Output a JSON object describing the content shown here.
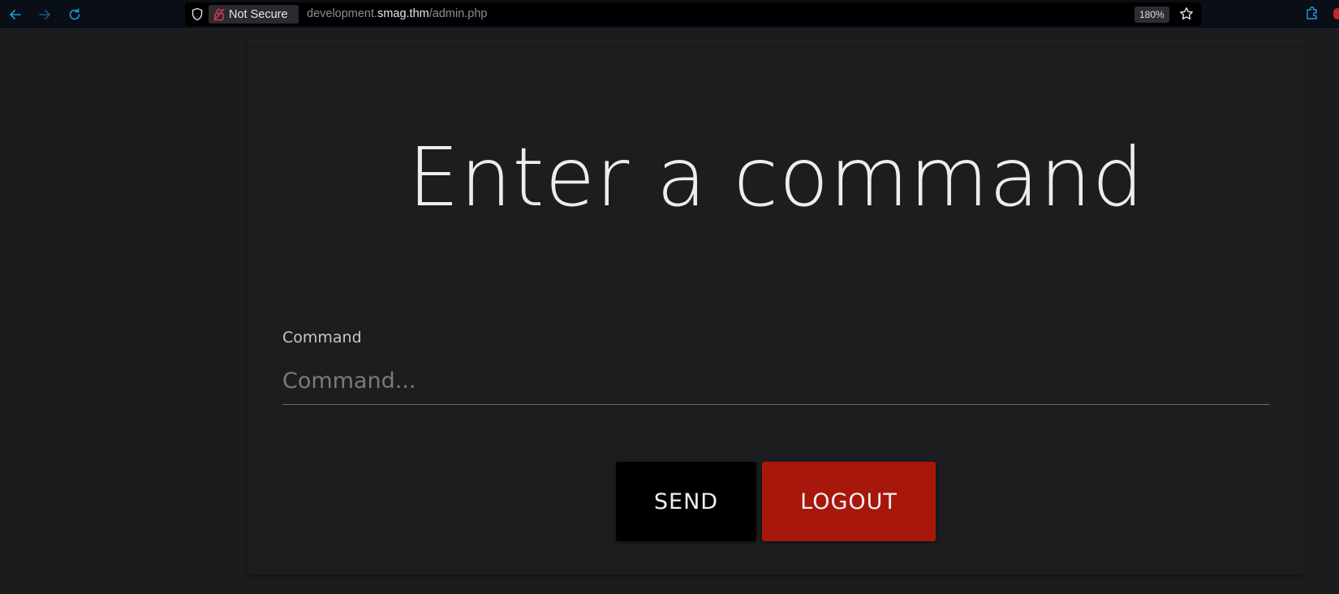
{
  "browser": {
    "security_label": "Not Secure",
    "url": {
      "prefix": "development.",
      "host": "smag.thm",
      "path": "/admin.php"
    },
    "zoom": "180%",
    "icons": {
      "back": "arrow-left-icon",
      "forward": "arrow-right-icon",
      "reload": "reload-icon",
      "tracking": "shield-icon",
      "insecure": "lock-broken-icon",
      "bookmark": "star-icon",
      "extensions": "extensions-icon"
    },
    "colors": {
      "accent": "#1a9bd7",
      "insecure_red": "#d6365a"
    }
  },
  "page": {
    "title": "Enter a command",
    "command": {
      "label": "Command",
      "placeholder": "Command...",
      "value": ""
    },
    "buttons": {
      "send": "SEND",
      "logout": "LOGOUT"
    },
    "colors": {
      "background": "#1b1c1e",
      "send_button": "#000000",
      "logout_button": "#a8170c",
      "heading": "#ededeb"
    }
  }
}
